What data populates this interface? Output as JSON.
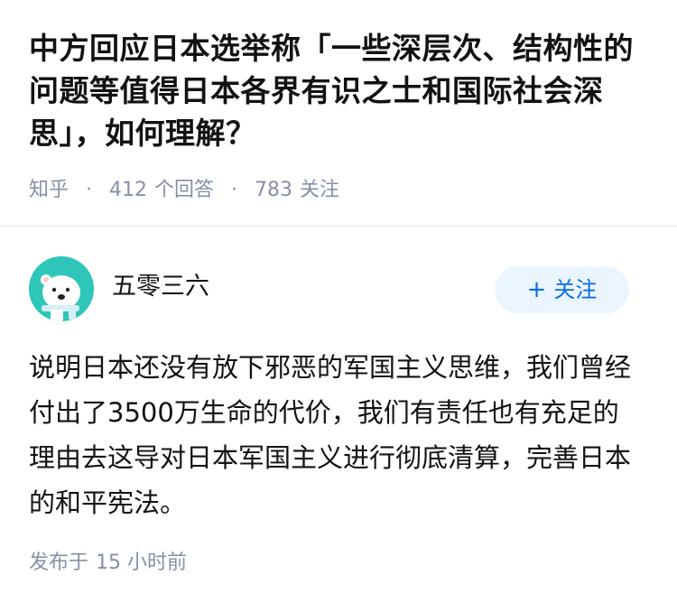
{
  "question": {
    "title": "中方回应日本选举称「一些深层次、结构性的问题等值得日本各界有识之士和国际社会深思」，如何理解？",
    "source": "知乎",
    "separator": "·",
    "answer_count": "412",
    "answer_unit": "个回答",
    "follow_count": "783",
    "follow_unit": "关注"
  },
  "answer": {
    "author_name": "五零三六",
    "follow_button_label": "关注",
    "follow_button_icon": "plus-icon",
    "avatar_icon": "polar-bear-avatar",
    "content": "说明日本还没有放下邪恶的军国主义思维，我们曾经付出了3500万生命的代价，我们有责任也有充足的理由去这导对日本军国主义进行彻底清算，完善日本的和平宪法。",
    "publish_label": "发布于",
    "publish_time": "15 小时前"
  },
  "colors": {
    "title": "#121212",
    "meta": "#8590a6",
    "follow_button_bg": "#ebf5ff",
    "follow_button_text": "#056de8",
    "avatar_bg": "#2ec6b8",
    "divider": "#f0f2f7"
  }
}
